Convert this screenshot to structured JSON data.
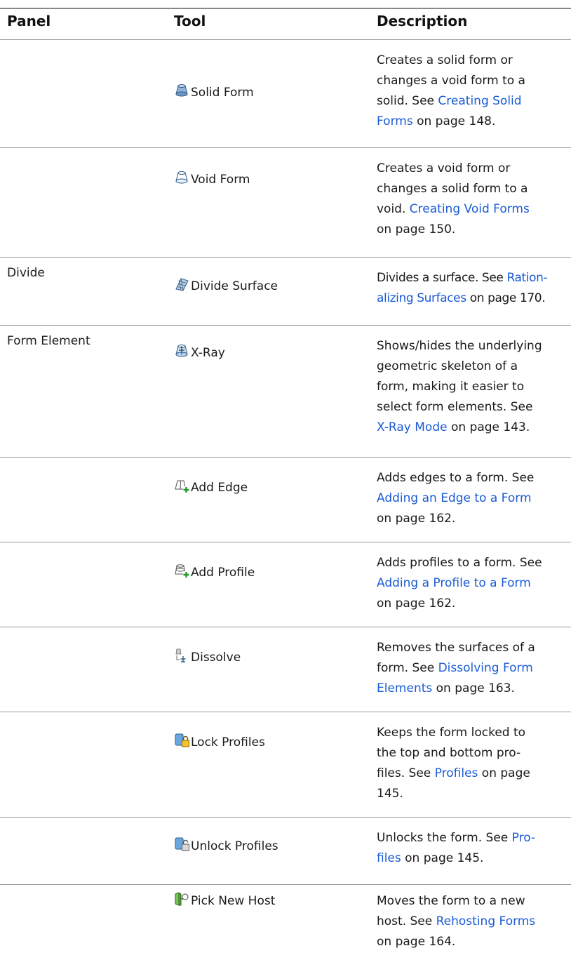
{
  "headers": {
    "panel": "Panel",
    "tool": "Tool",
    "description": "Description"
  },
  "rows": [
    {
      "panel": "",
      "tool": "Solid Form",
      "icon": "solid-form-icon",
      "d1": "Creates a solid form or",
      "d2": "changes a void form to a",
      "d3a": "solid. See ",
      "link": "Creating Solid",
      "d4a": "Forms",
      "d4b": " on page 148."
    },
    {
      "panel": "",
      "tool": "Void Form",
      "icon": "void-form-icon",
      "d1": "Creates a void form or",
      "d2": "changes a solid form to a",
      "d3a": "void. ",
      "link": "Creating Void Forms",
      "d4": "on page 150."
    },
    {
      "panel": "Divide",
      "tool": "Divide Surface",
      "icon": "divide-surface-icon",
      "d1a": "Divides a surface. See ",
      "link1": "Ration-",
      "link2": "alizing Surfaces",
      "d2b": " on page 170."
    },
    {
      "panel": "Form Element",
      "tool": "X-Ray",
      "icon": "x-ray-icon",
      "d1": "Shows/hides the underlying",
      "d2": "geometric skeleton of a",
      "d3": "form, making it easier to",
      "d4": "select form elements. See",
      "link": "X-Ray Mode",
      "d5b": " on page 143."
    },
    {
      "panel": "",
      "tool": "Add Edge",
      "icon": "add-edge-icon",
      "d1": "Adds edges to a form. See",
      "link": "Adding an Edge to a Form",
      "d3": "on page 162."
    },
    {
      "panel": "",
      "tool": "Add Profile",
      "icon": "add-profile-icon",
      "d1": "Adds profiles to a form. See",
      "link": "Adding a Profile to a Form",
      "d3": "on page 162."
    },
    {
      "panel": "",
      "tool": "Dissolve",
      "icon": "dissolve-icon",
      "d1": "Removes the surfaces of a",
      "d2a": "form. See ",
      "link1": "Dissolving Form",
      "link2": "Elements",
      "d3b": " on page 163."
    },
    {
      "panel": "",
      "tool": "Lock Profiles",
      "icon": "lock-profiles-icon",
      "d1": "Keeps the form locked to",
      "d2": "the top and bottom pro-",
      "d3a": "files. See ",
      "link": "Profiles",
      "d3b": " on page",
      "d4": "145."
    },
    {
      "panel": "",
      "tool": "Unlock Profiles",
      "icon": "unlock-profiles-icon",
      "d1a": "Unlocks the form. See ",
      "link1": "Pro-",
      "link2": "files",
      "d2b": " on page 145."
    },
    {
      "panel": "",
      "tool": "Pick New Host",
      "icon": "pick-new-host-icon",
      "d1": "Moves the form to a new",
      "d2a": "host. See ",
      "link": "Rehosting Forms",
      "d3": "on page 164."
    }
  ],
  "colors": {
    "link": "#1a5bd6",
    "rule": "#9a9a9a"
  }
}
